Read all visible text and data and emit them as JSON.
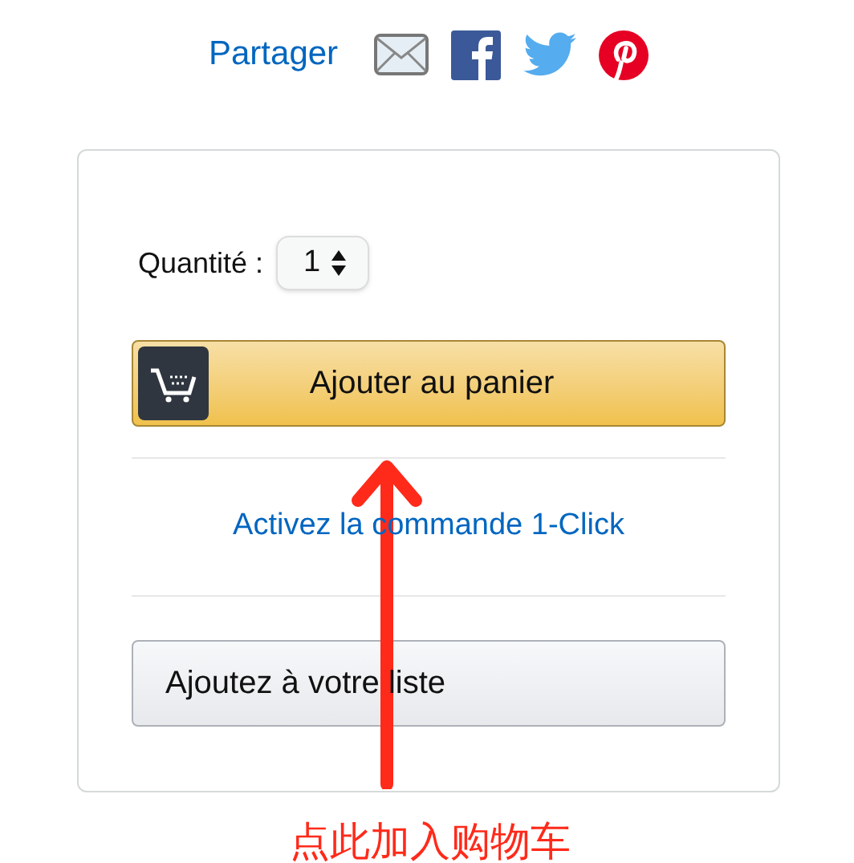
{
  "share": {
    "label": "Partager"
  },
  "quantity": {
    "label": "Quantité :",
    "value": "1"
  },
  "add_to_cart_button": {
    "label": "Ajouter au panier"
  },
  "one_click_link": {
    "label": "Activez la commande 1-Click"
  },
  "add_to_list_button": {
    "label": "Ajoutez à votre liste"
  },
  "annotation": {
    "label": "点此加入购物车"
  }
}
